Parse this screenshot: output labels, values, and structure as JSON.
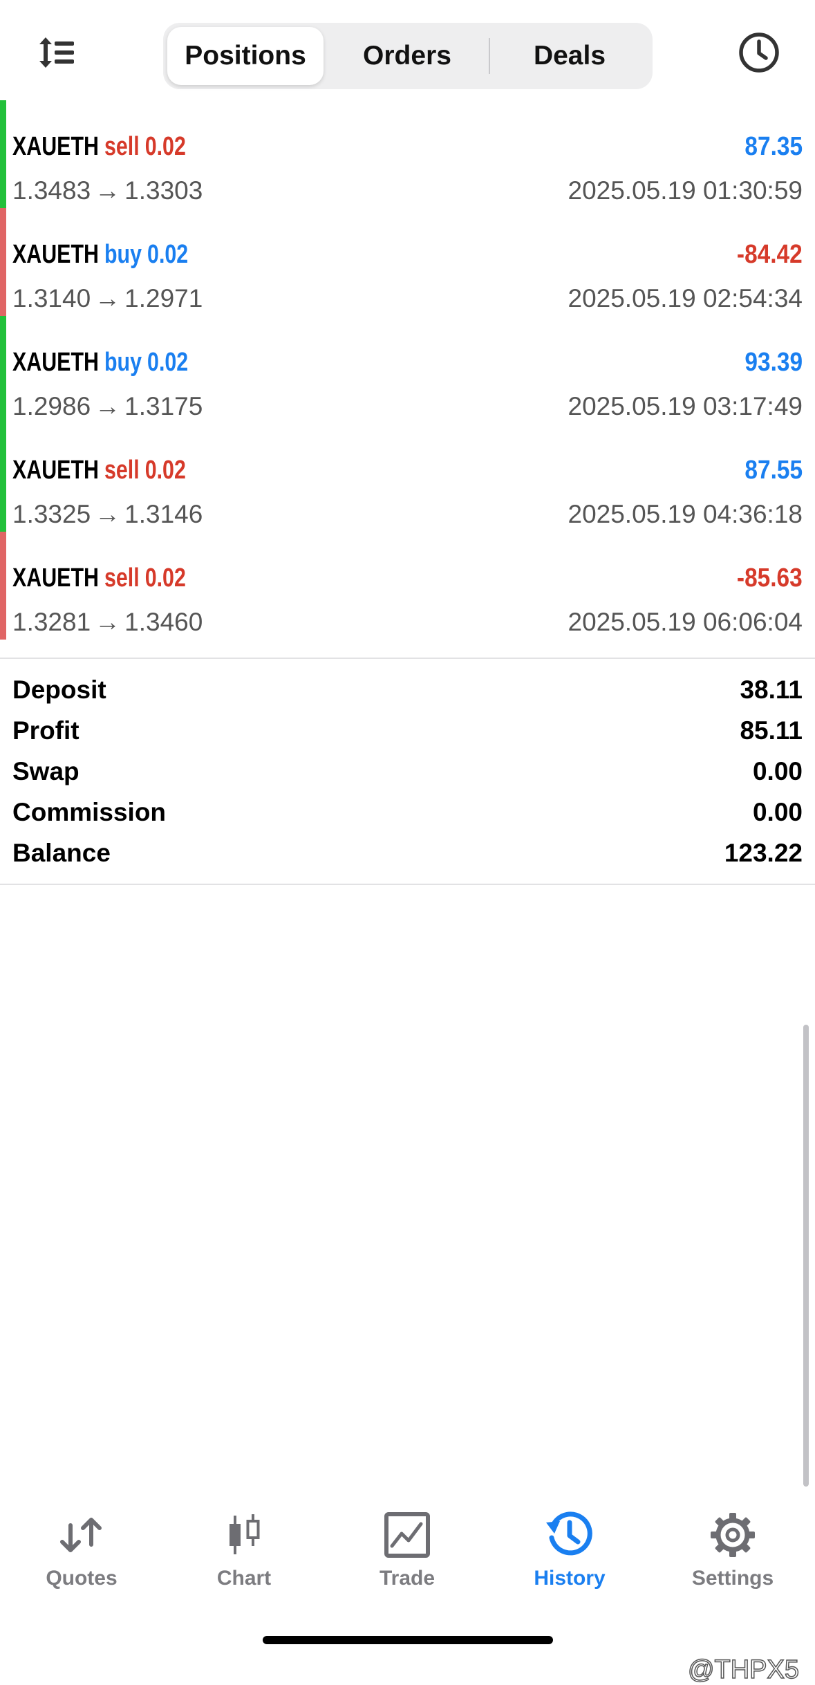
{
  "colors": {
    "accent": "#1a7ff0",
    "sell": "#d63a2a",
    "loss": "#d63a2a",
    "profit": "#1a7ff0",
    "bar_green": "#22c03a",
    "bar_red": "#e06565",
    "inactive": "#7c7c80"
  },
  "header": {
    "sort_icon": "sort-icon",
    "clock_icon": "clock-icon",
    "tabs": [
      {
        "label": "Positions",
        "active": true
      },
      {
        "label": "Orders",
        "active": false
      },
      {
        "label": "Deals",
        "active": false
      }
    ]
  },
  "deals": [
    {
      "symbol": "XAUETH",
      "side": "sell",
      "volume": "0.02",
      "profit": "87.35",
      "open_price": "1.3483",
      "close_price": "1.3303",
      "time": "2025.05.19 01:30:59",
      "bar": "green"
    },
    {
      "symbol": "XAUETH",
      "side": "buy",
      "volume": "0.02",
      "profit": "-84.42",
      "open_price": "1.3140",
      "close_price": "1.2971",
      "time": "2025.05.19 02:54:34",
      "bar": "red"
    },
    {
      "symbol": "XAUETH",
      "side": "buy",
      "volume": "0.02",
      "profit": "93.39",
      "open_price": "1.2986",
      "close_price": "1.3175",
      "time": "2025.05.19 03:17:49",
      "bar": "green"
    },
    {
      "symbol": "XAUETH",
      "side": "sell",
      "volume": "0.02",
      "profit": "87.55",
      "open_price": "1.3325",
      "close_price": "1.3146",
      "time": "2025.05.19 04:36:18",
      "bar": "green"
    },
    {
      "symbol": "XAUETH",
      "side": "sell",
      "volume": "0.02",
      "profit": "-85.63",
      "open_price": "1.3281",
      "close_price": "1.3460",
      "time": "2025.05.19 06:06:04",
      "bar": "red"
    }
  ],
  "arrow_glyph": "→",
  "summary": [
    {
      "label": "Deposit",
      "value": "38.11"
    },
    {
      "label": "Profit",
      "value": "85.11"
    },
    {
      "label": "Swap",
      "value": "0.00"
    },
    {
      "label": "Commission",
      "value": "0.00"
    },
    {
      "label": "Balance",
      "value": "123.22"
    }
  ],
  "tabbar": [
    {
      "label": "Quotes",
      "icon": "quotes-icon",
      "active": false
    },
    {
      "label": "Chart",
      "icon": "candlestick-chart-icon",
      "active": false
    },
    {
      "label": "Trade",
      "icon": "trade-icon",
      "active": false
    },
    {
      "label": "History",
      "icon": "history-icon",
      "active": true
    },
    {
      "label": "Settings",
      "icon": "gear-icon",
      "active": false
    }
  ],
  "watermark": "@THPX5"
}
